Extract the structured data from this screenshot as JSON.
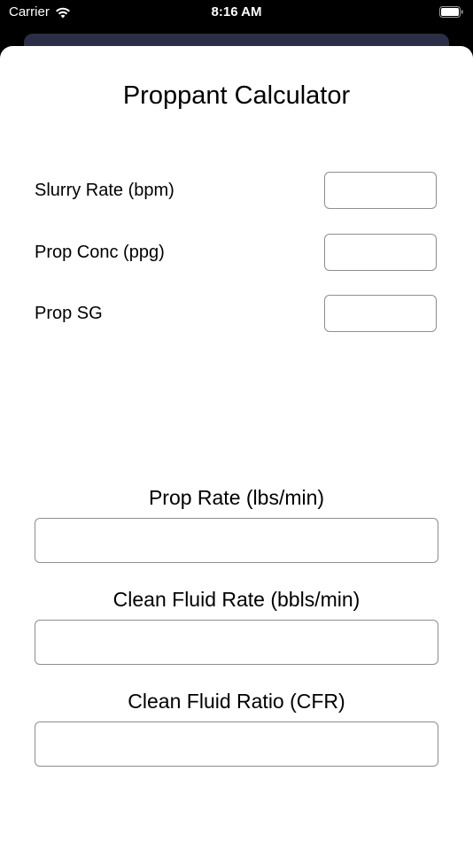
{
  "status_bar": {
    "carrier": "Carrier",
    "time": "8:16 AM",
    "wifi_icon": "wifi-icon",
    "battery_icon": "battery-icon"
  },
  "calculator": {
    "title": "Proppant Calculator",
    "inputs": [
      {
        "label": "Slurry Rate (bpm)",
        "value": ""
      },
      {
        "label": "Prop Conc (ppg)",
        "value": ""
      },
      {
        "label": "Prop SG",
        "value": ""
      }
    ],
    "results": [
      {
        "label": "Prop Rate (lbs/min)",
        "value": ""
      },
      {
        "label": "Clean Fluid Rate (bbls/min)",
        "value": ""
      },
      {
        "label": "Clean Fluid Ratio (CFR)",
        "value": ""
      }
    ]
  },
  "colors": {
    "background": "#000000",
    "sheet": "#ffffff",
    "back_card": "#2b2f45",
    "field_border": "#8e8e93"
  }
}
